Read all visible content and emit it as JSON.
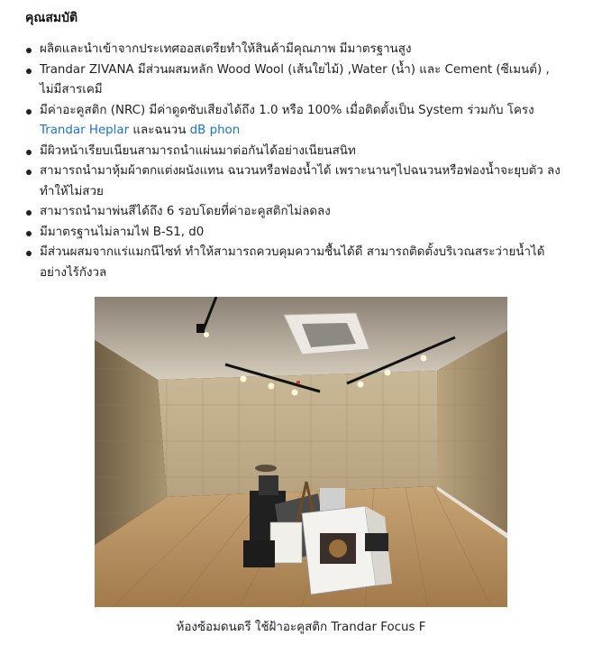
{
  "section": {
    "heading": "คุณสมบัติ"
  },
  "features": [
    {
      "text": "ผลิตและนำเข้าจากประเทศออสเตรียทำให้สินค้ามีคุณภาพ มีมาตรฐานสูง"
    },
    {
      "text": "Trandar ZIVANA มีส่วนผสมหลัก Wood Wool (เส้นใยไม้) ,Water (น้ำ) และ Cement (ซีเมนต์) , ไม่มีสารเคมี"
    },
    {
      "text_before": "มีค่าอะคูสติก (NRC) มีค่าดูดซับเสียงได้ถึง 1.0 หรือ 100% เมื่อติดตั้งเป็น System ร่วมกับ โครง ",
      "link1": "Trandar Heplar",
      "text_middle": " และฉนวน ",
      "link2": "dB phon"
    },
    {
      "text": "มีผิวหน้าเรียบเนียนสามารถนำแผ่นมาต่อกันได้อย่างเนียนสนิท"
    },
    {
      "text": "สามารถนำมาหุ้มผ้าตกแต่งผนังแทน ฉนวนหรือฟองน้ำได้ เพราะนานๆไปฉนวนหรือฟองน้ำจะยุบตัว ลง ทำให้ไม่สวย"
    },
    {
      "text": "สามารถนำมาพ่นสีได้ถึง 6 รอบโดยที่ค่าอะคูสติกไม่ลดลง"
    },
    {
      "text": "มีมาตรฐานไม่ลามไฟ B-S1, d0"
    },
    {
      "text": "มีส่วนผสมจากแร่แมกนีไซท์ ทำให้สามารถควบคุมความชื้นได้ดี สามารถติดตั้งบริเวณสระว่ายน้ำได้ อย่างไร้กังวล"
    }
  ],
  "figure": {
    "caption": "ห้องซ้อมดนตรี ใช้ฝ้าอะคูสติก Trandar Focus F"
  }
}
